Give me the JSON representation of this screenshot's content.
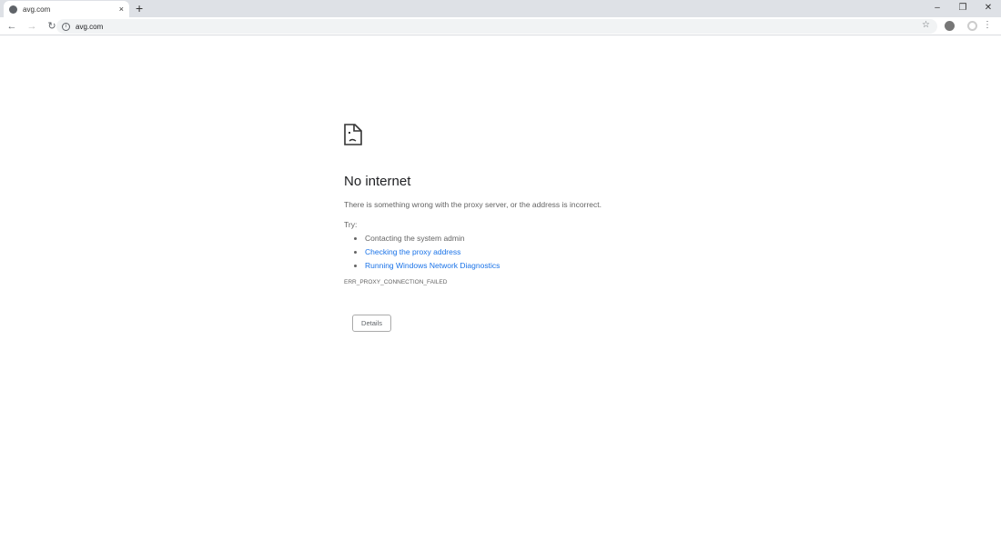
{
  "browser": {
    "tab": {
      "title": "avg.com",
      "close": "×"
    },
    "new_tab": "+",
    "window": {
      "minimize": "–",
      "restore": "❐",
      "close": "✕"
    },
    "nav": {
      "back": "←",
      "forward": "→",
      "reload": "↻"
    },
    "address": "avg.com",
    "star": "☆",
    "menu": "⋮"
  },
  "error": {
    "title": "No internet",
    "description": "There is something wrong with the proxy server, or the address is incorrect.",
    "try_label": "Try:",
    "suggestions": [
      "Contacting the system admin",
      "Checking the proxy address",
      "Running Windows Network Diagnostics"
    ],
    "code": "ERR_PROXY_CONNECTION_FAILED",
    "details_button": "Details"
  }
}
